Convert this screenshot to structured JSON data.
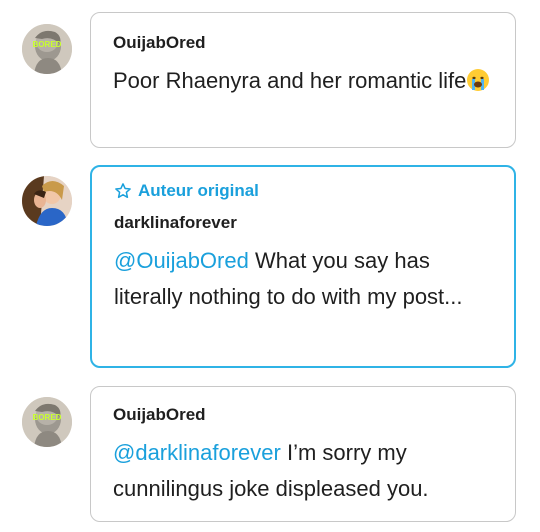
{
  "replies": [
    {
      "username": "OuijabOred",
      "avatar_icon": "greek-bust-avatar",
      "avatar_badge": "BORED",
      "is_original_author": false,
      "mention": "",
      "text": "Poor Rhaenyra and her romantic life",
      "emoji": "crying-face-emoji"
    },
    {
      "username": "darklinaforever",
      "avatar_icon": "illustrated-couple-avatar",
      "is_original_author": true,
      "badge_label": "Auteur original",
      "mention": "@OuijabOred",
      "text": " What you say has literally nothing to do with my post..."
    },
    {
      "username": "OuijabOred",
      "avatar_icon": "greek-bust-avatar",
      "avatar_badge": "BORED",
      "is_original_author": false,
      "mention": "@darklinaforever",
      "text": " I’m sorry my cunnilingus joke displeased you."
    }
  ],
  "colors": {
    "accent": "#1aa0dc",
    "border": "#c8c8c8",
    "text": "#1f1f1f"
  }
}
